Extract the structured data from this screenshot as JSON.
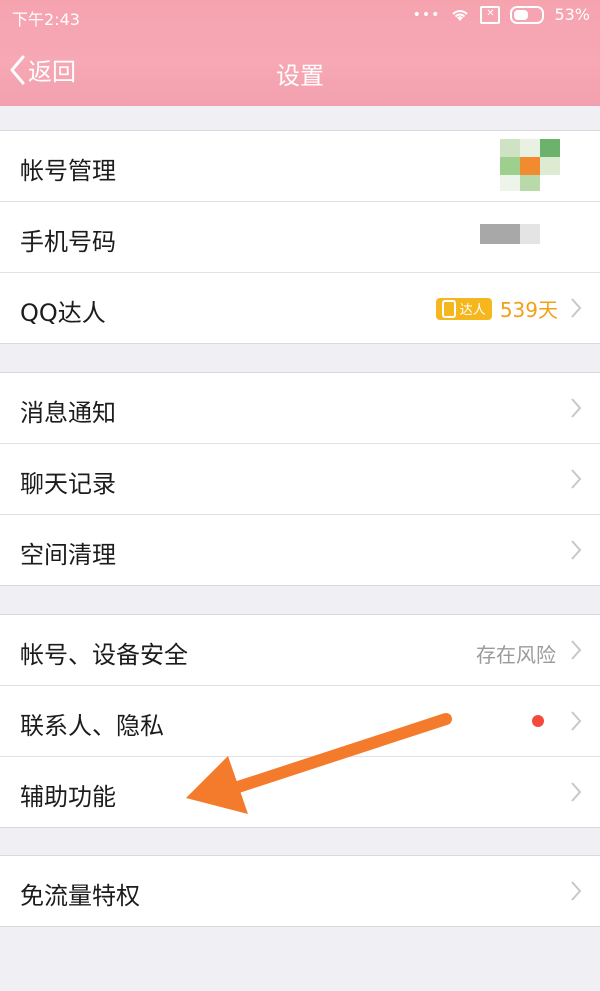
{
  "status": {
    "time": "下午2:43",
    "dots": "•••",
    "sim": "✕",
    "battery": "53%"
  },
  "nav": {
    "back_label": "返回",
    "title": "设置"
  },
  "groups": [
    {
      "items": [
        {
          "label": "帐号管理"
        },
        {
          "label": "手机号码"
        },
        {
          "label": "QQ达人",
          "badge": "达人",
          "days": "539天"
        }
      ]
    },
    {
      "items": [
        {
          "label": "消息通知"
        },
        {
          "label": "聊天记录"
        },
        {
          "label": "空间清理"
        }
      ]
    },
    {
      "items": [
        {
          "label": "帐号、设备安全",
          "value": "存在风险"
        },
        {
          "label": "联系人、隐私"
        },
        {
          "label": "辅助功能"
        }
      ]
    },
    {
      "items": [
        {
          "label": "免流量特权"
        }
      ]
    }
  ],
  "colors": {
    "header": "#f6a3b0",
    "badge": "#f5b71d",
    "days": "#f0a115",
    "dot": "#f34a3d",
    "arrow": "#f47b2b"
  }
}
